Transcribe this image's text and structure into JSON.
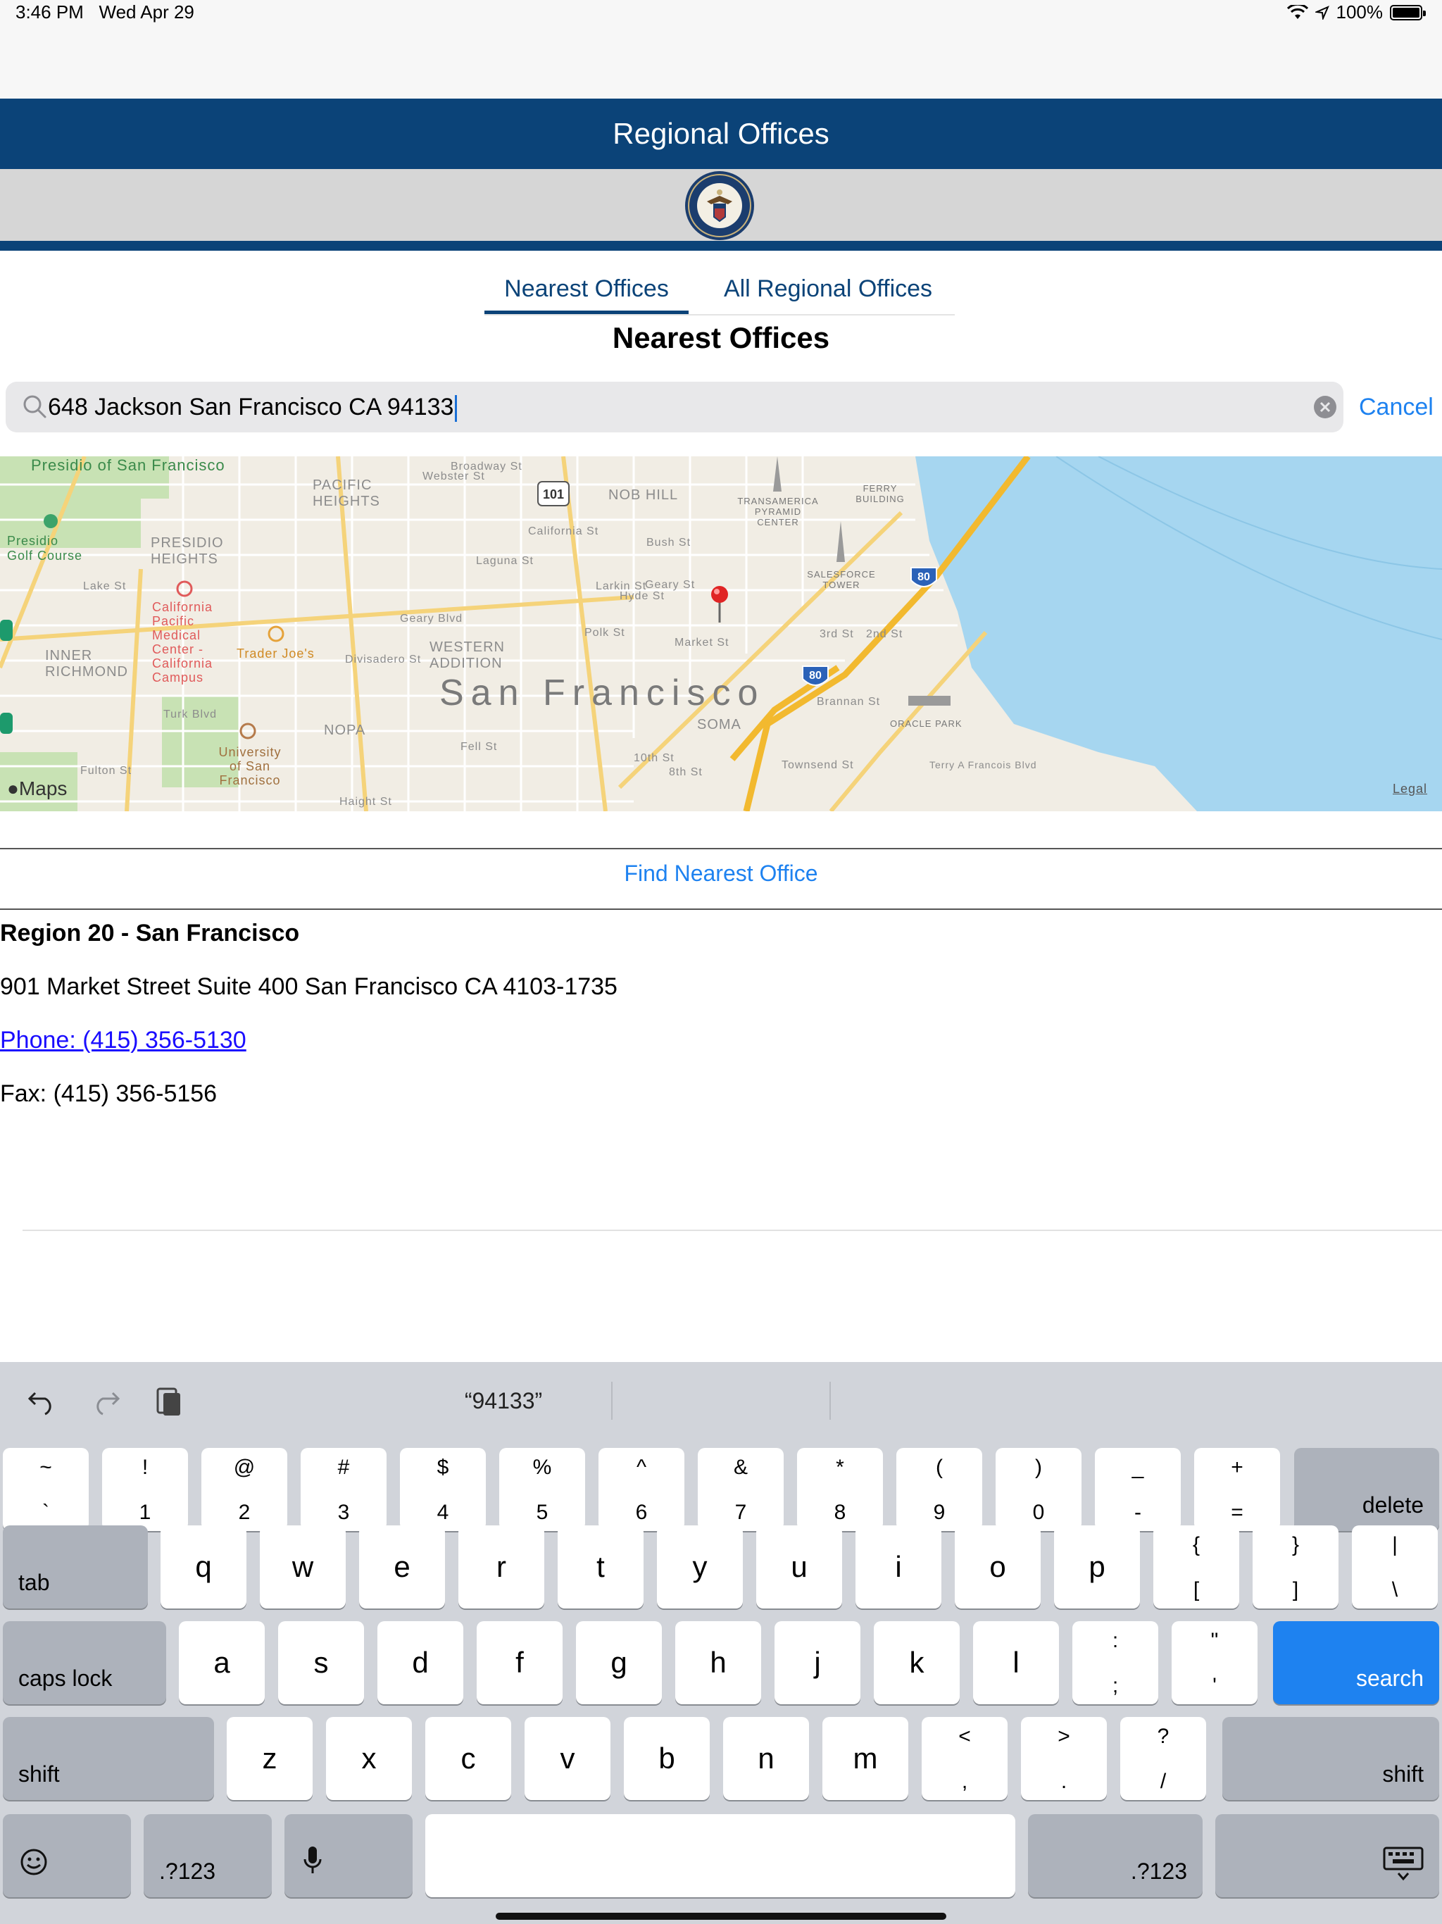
{
  "status_bar": {
    "time": "3:46 PM",
    "date": "Wed Apr 29",
    "battery": "100%"
  },
  "header": {
    "title": "Regional Offices"
  },
  "tabs": [
    {
      "label": "Nearest Offices",
      "selected": true
    },
    {
      "label": "All Regional Offices",
      "selected": false
    }
  ],
  "section_title": "Nearest Offices",
  "search": {
    "value": "648 Jackson San Francisco CA 94133",
    "cancel_label": "Cancel"
  },
  "map": {
    "attribution": "Maps",
    "legal": "Legal",
    "city_label": "San Francisco",
    "neighborhoods": [
      "PACIFIC HEIGHTS",
      "PRESIDIO HEIGHTS",
      "NOB HILL",
      "INNER RICHMOND",
      "WESTERN ADDITION",
      "NOPA",
      "SOMA"
    ],
    "places": [
      "Presidio of San Francisco",
      "Presidio Golf Course",
      "California Pacific Medical Center - California Campus",
      "Trader Joe's",
      "University of San Francisco",
      "TRANSAMERICA PYRAMID CENTER",
      "FERRY BUILDING",
      "SALESFORCE TOWER",
      "ORACLE PARK"
    ],
    "streets": [
      "Broadway St",
      "California St",
      "Bush St",
      "Geary St",
      "Geary Blvd",
      "Lake St",
      "Turk Blvd",
      "Fulton St",
      "Fell St",
      "Market St",
      "3rd St",
      "2nd St",
      "Brannan St",
      "Townsend St",
      "10th St",
      "8th St",
      "Divisadero St",
      "Laguna St",
      "Larkin St",
      "Polk St",
      "Hyde St",
      "Webster St",
      "Terry A Francois Blvd",
      "Haight St"
    ],
    "highway_shields": [
      "101",
      "80",
      "80"
    ]
  },
  "find_nearest_label": "Find Nearest Office",
  "result": {
    "name": "Region 20 - San Francisco",
    "address": "901 Market Street Suite 400 San Francisco CA 4103-1735",
    "phone": "Phone: (415) 356-5130",
    "fax": "Fax: (415) 356-5156"
  },
  "keyboard": {
    "suggestion": "“94133”",
    "number_row": [
      [
        "~",
        "`"
      ],
      [
        "!",
        "1"
      ],
      [
        "@",
        "2"
      ],
      [
        "#",
        "3"
      ],
      [
        "$",
        "4"
      ],
      [
        "%",
        "5"
      ],
      [
        "^",
        "6"
      ],
      [
        "&",
        "7"
      ],
      [
        "*",
        "8"
      ],
      [
        "(",
        "9"
      ],
      [
        ")",
        "0"
      ],
      [
        "_",
        "-"
      ],
      [
        "+",
        "="
      ]
    ],
    "delete_label": "delete",
    "tab_label": "tab",
    "row_q": [
      "q",
      "w",
      "e",
      "r",
      "t",
      "y",
      "u",
      "i",
      "o",
      "p"
    ],
    "row_q_symbols": [
      [
        "{",
        "["
      ],
      [
        "}",
        "]"
      ],
      [
        "|",
        "\\"
      ]
    ],
    "caps_label": "caps lock",
    "row_a": [
      "a",
      "s",
      "d",
      "f",
      "g",
      "h",
      "j",
      "k",
      "l"
    ],
    "row_a_symbols": [
      [
        ":",
        ";"
      ],
      [
        "\"",
        "'"
      ]
    ],
    "search_label": "search",
    "shift_label": "shift",
    "row_z": [
      "z",
      "x",
      "c",
      "v",
      "b",
      "n",
      "m"
    ],
    "row_z_symbols": [
      [
        "<",
        ","
      ],
      [
        ">",
        "."
      ],
      [
        "?",
        "/"
      ]
    ],
    "num_label": ".?123"
  },
  "colors": {
    "brand_navy": "#0b4378",
    "link_blue": "#1e82f0",
    "search_key": "#1e82f0"
  }
}
